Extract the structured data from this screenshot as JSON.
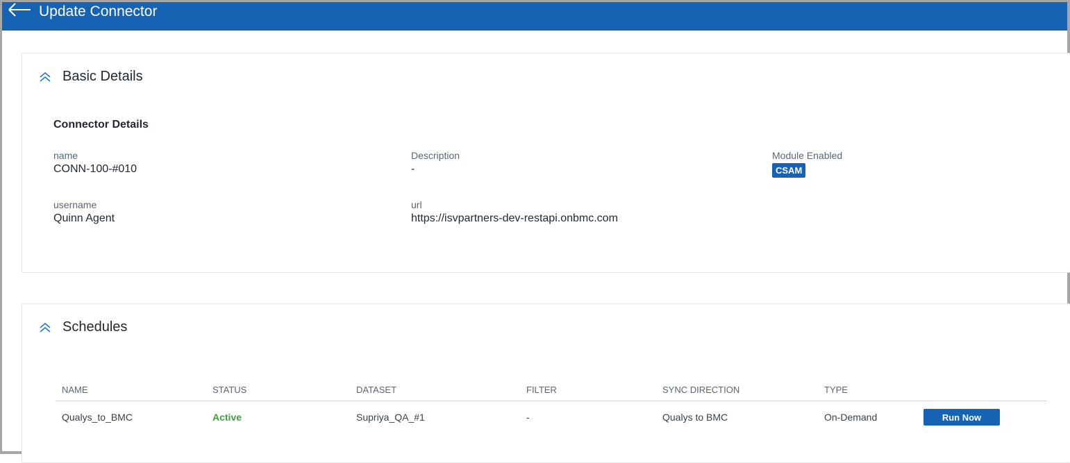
{
  "header": {
    "title": "Update Connector"
  },
  "basic": {
    "title": "Basic Details",
    "subtitle": "Connector Details",
    "fields": {
      "name": {
        "label": "name",
        "value": "CONN-100-#010"
      },
      "description": {
        "label": "Description",
        "value": "-"
      },
      "module": {
        "label": "Module Enabled",
        "value": "CSAM"
      },
      "username": {
        "label": "username",
        "value": "Quinn Agent"
      },
      "url": {
        "label": "url",
        "value": "https://isvpartners-dev-restapi.onbmc.com"
      }
    }
  },
  "schedules": {
    "title": "Schedules",
    "columns": [
      "NAME",
      "STATUS",
      "DATASET",
      "FILTER",
      "SYNC DIRECTION",
      "TYPE"
    ],
    "rows": [
      {
        "name": "Qualys_to_BMC",
        "status": "Active",
        "dataset": "Supriya_QA_#1",
        "filter": "-",
        "sync": "Qualys to BMC",
        "type": "On-Demand",
        "action": "Run Now"
      }
    ]
  },
  "colors": {
    "brand": "#1763b3",
    "active": "#3fa23b"
  }
}
